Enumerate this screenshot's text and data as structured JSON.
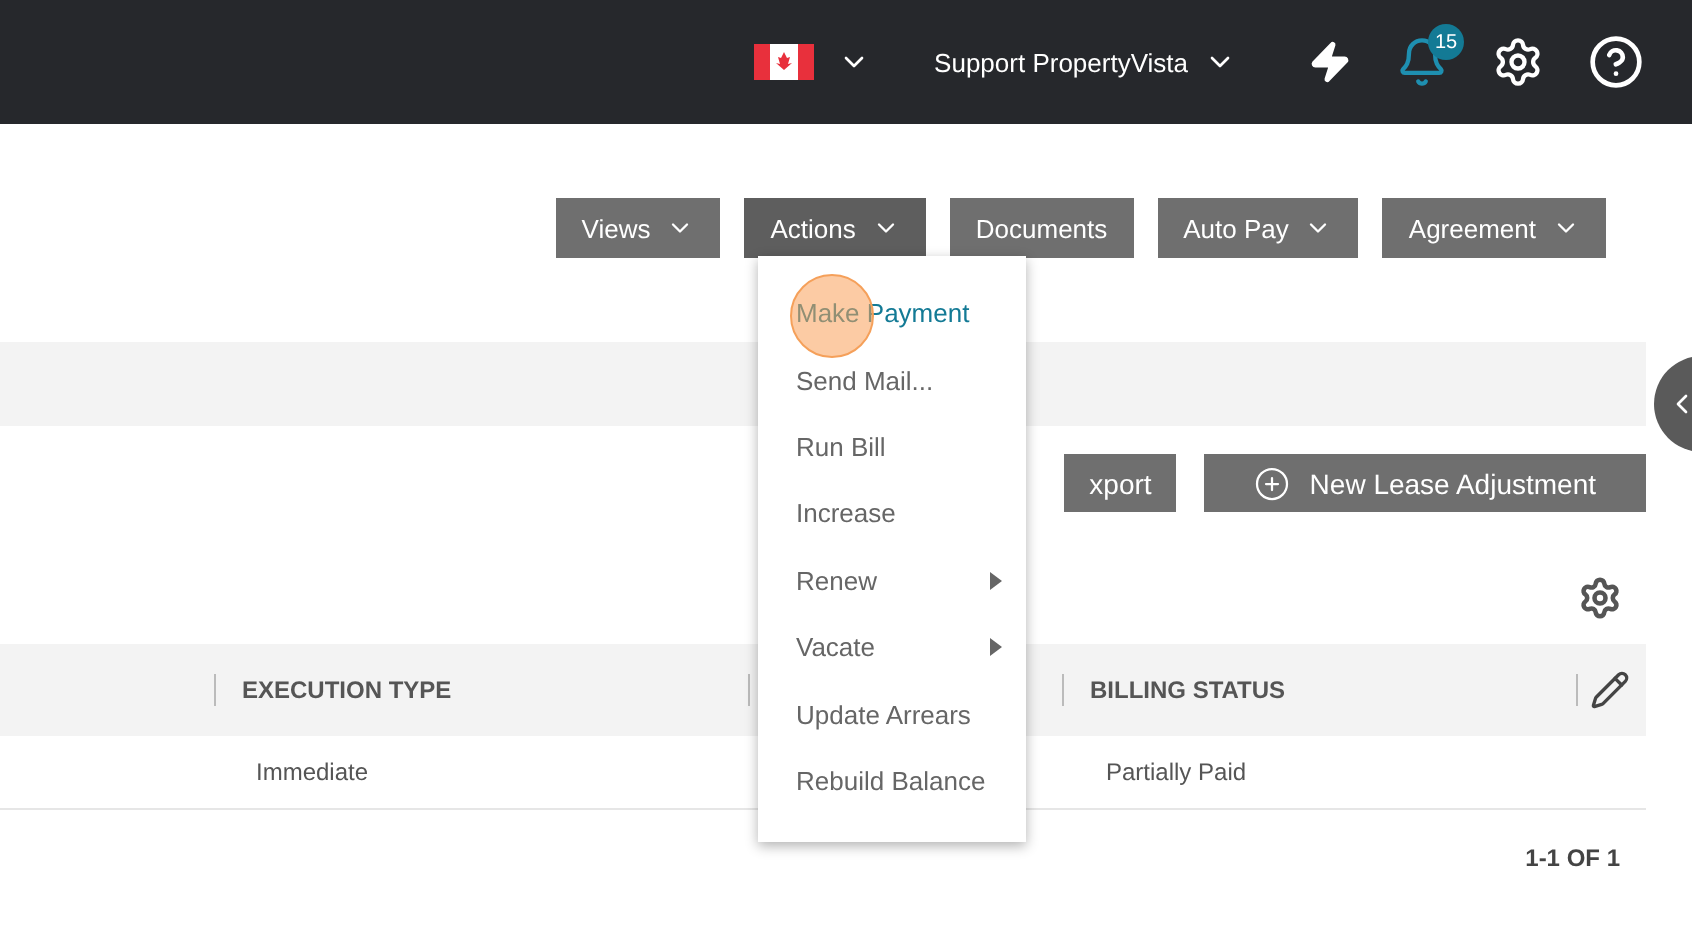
{
  "top_bar": {
    "user": "Support PropertyVista",
    "notifications": "15"
  },
  "toolbar": [
    {
      "label": "Views",
      "kind": "dropdown",
      "selected": false
    },
    {
      "label": "Actions",
      "kind": "dropdown",
      "selected": true
    },
    {
      "label": "Documents",
      "kind": "plain",
      "selected": false
    },
    {
      "label": "Auto Pay",
      "kind": "dropdown",
      "selected": false
    },
    {
      "label": "Agreement",
      "kind": "dropdown",
      "selected": false
    }
  ],
  "actions_menu": [
    {
      "label": "Make Payment",
      "kind": "item",
      "selected": true
    },
    {
      "label": "Send Mail...",
      "kind": "item",
      "selected": false
    },
    {
      "label": "Run Bill",
      "kind": "item",
      "selected": false
    },
    {
      "label": "Increase",
      "kind": "item",
      "selected": false
    },
    {
      "label": "Renew",
      "kind": "submenu",
      "selected": false
    },
    {
      "label": "Vacate",
      "kind": "submenu",
      "selected": false
    },
    {
      "label": "Update Arrears",
      "kind": "item",
      "selected": false
    },
    {
      "label": "Rebuild Balance",
      "kind": "item",
      "selected": false
    }
  ],
  "buttons": [
    {
      "label": "xport",
      "kind": "plain"
    },
    {
      "label": "New Lease Adjustment",
      "kind": "add"
    }
  ],
  "table": {
    "columns": [
      "EXECUTION TYPE",
      "BILLING STATUS"
    ],
    "rows": [
      [
        "Immediate",
        "Partially Paid"
      ]
    ]
  },
  "pagination": "1-1 OF 1"
}
